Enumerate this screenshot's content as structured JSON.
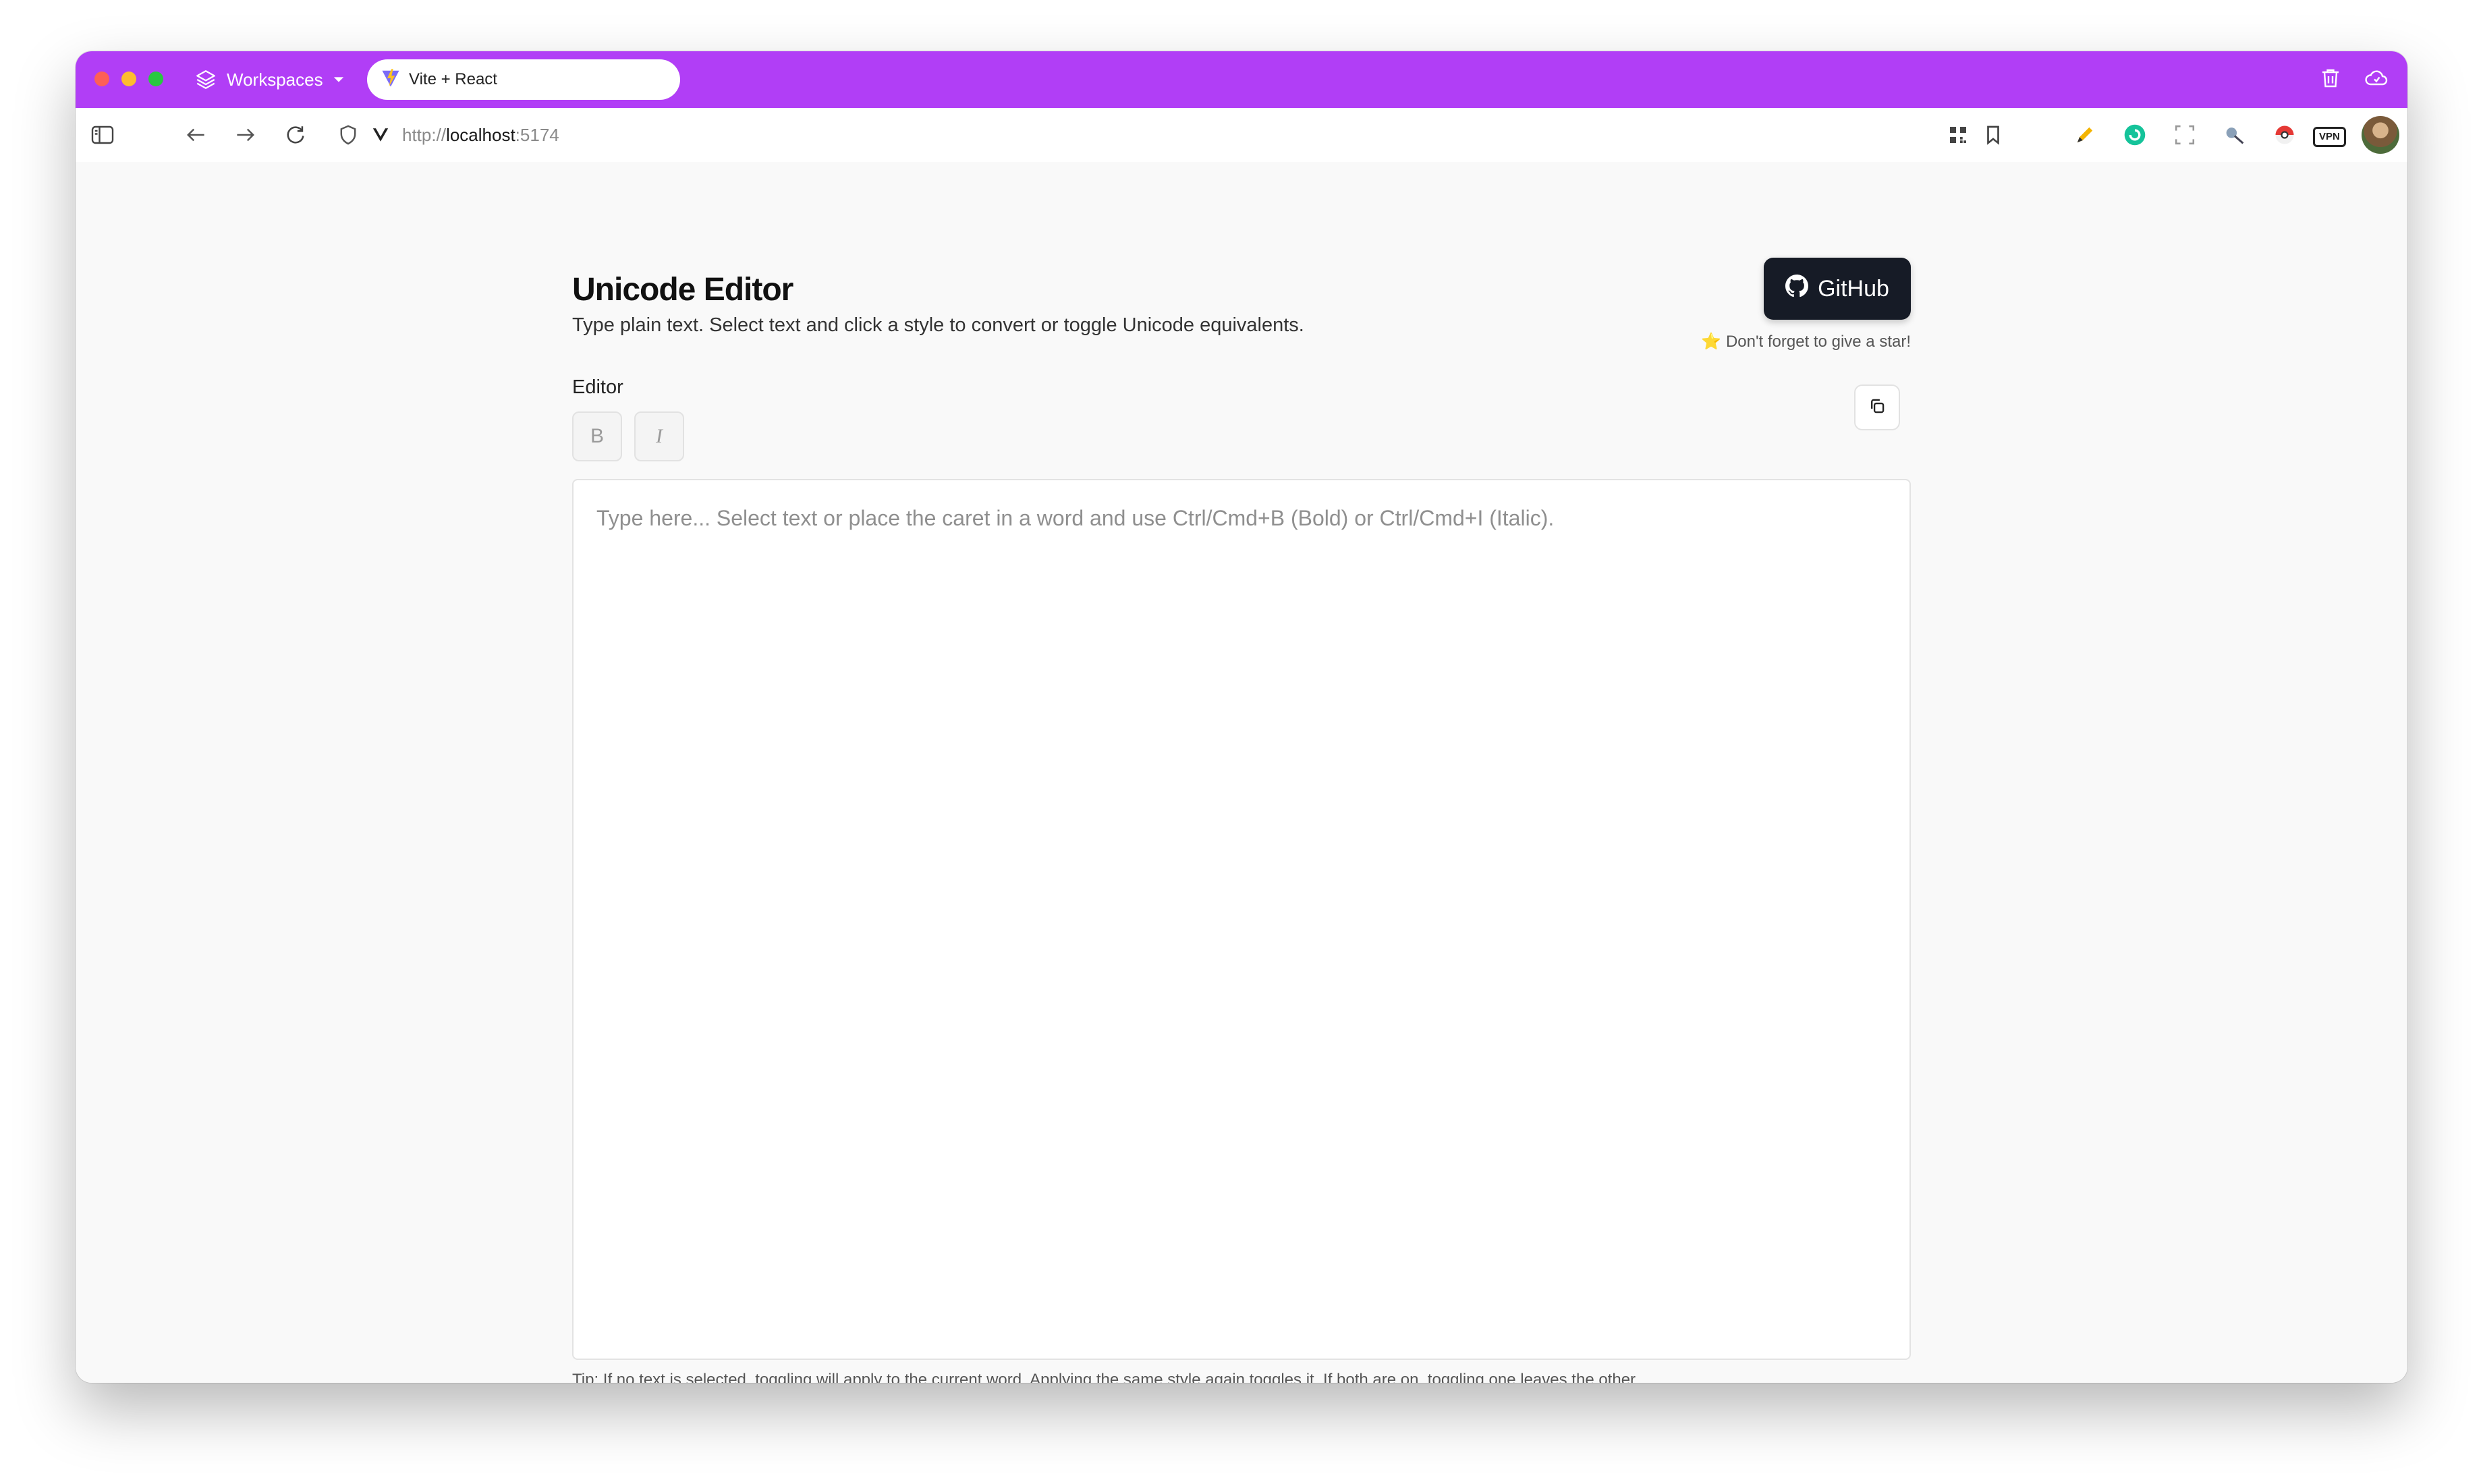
{
  "browser": {
    "workspaces_label": "Workspaces",
    "tab_title": "Vite + React",
    "url_scheme": "http://",
    "url_host": "localhost",
    "url_port": ":5174",
    "vpn_label": "VPN",
    "accent": "#b13ef6"
  },
  "header": {
    "title": "Unicode Editor",
    "subtitle": "Type plain text. Select text and click a style to convert or toggle Unicode equivalents.",
    "github_label": "GitHub",
    "star_note": "⭐ Don't forget to give a star!"
  },
  "editor": {
    "label": "Editor",
    "bold_label": "B",
    "italic_label": "I",
    "placeholder": "Type here... Select text or place the caret in a word and use Ctrl/Cmd+B (Bold) or Ctrl/Cmd+I (Italic).",
    "value": ""
  },
  "footer": {
    "tip": "Tip: If no text is selected, toggling will apply to the current word. Applying the same style again toggles it. If both are on, toggling one leaves the other."
  }
}
